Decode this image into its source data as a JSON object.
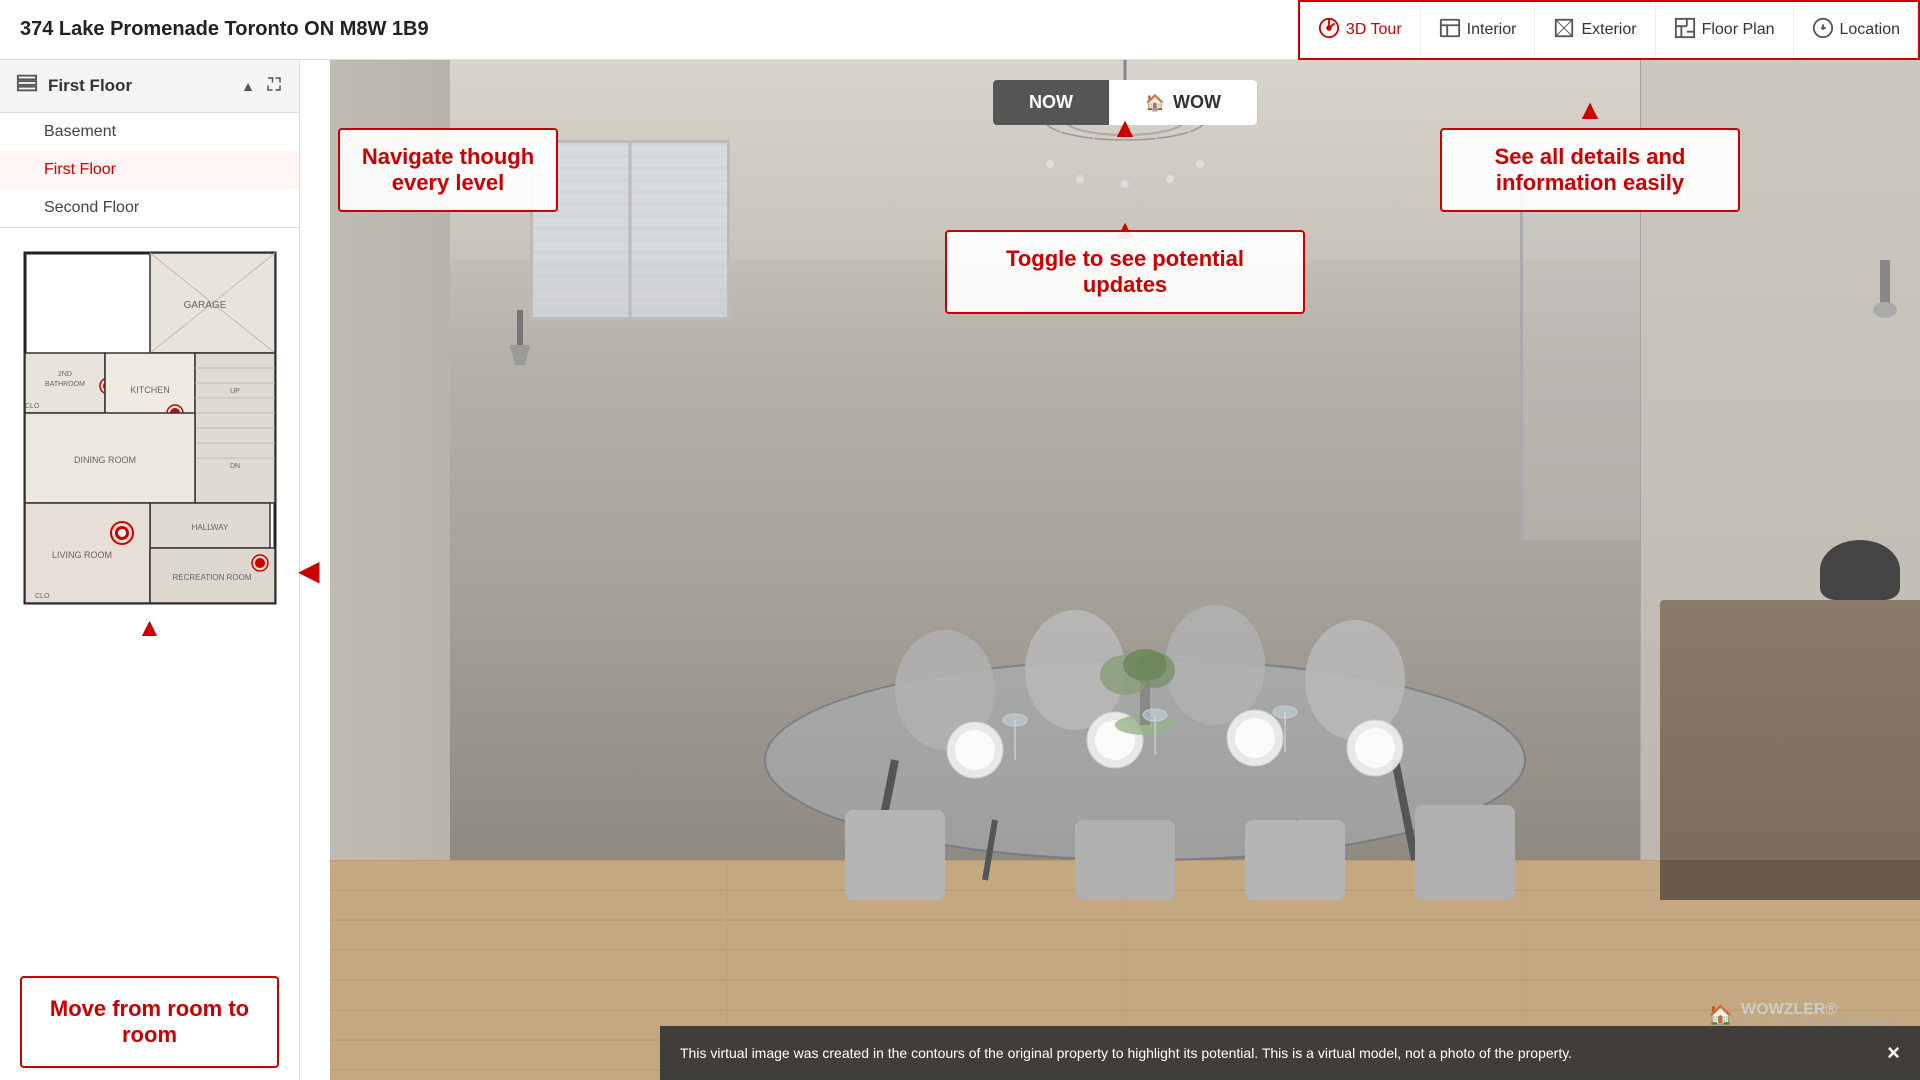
{
  "header": {
    "address": "374 Lake Promenade Toronto ON M8W 1B9"
  },
  "nav": {
    "items": [
      {
        "id": "3dtour",
        "label": "3D Tour",
        "icon": "⟳",
        "active": true
      },
      {
        "id": "interior",
        "label": "Interior",
        "icon": "🏠",
        "active": false
      },
      {
        "id": "exterior",
        "label": "Exterior",
        "icon": "🖼",
        "active": false
      },
      {
        "id": "floorplan",
        "label": "Floor Plan",
        "icon": "📋",
        "active": false
      },
      {
        "id": "location",
        "label": "Location",
        "icon": "ℹ",
        "active": false
      }
    ]
  },
  "sidebar": {
    "floor_selector_label": "First Floor",
    "floors": [
      {
        "id": "basement",
        "label": "Basement",
        "active": false
      },
      {
        "id": "first",
        "label": "First Floor",
        "active": true
      },
      {
        "id": "second",
        "label": "Second Floor",
        "active": false
      }
    ]
  },
  "toggle": {
    "now_label": "NOW",
    "wow_label": "WOW",
    "active": "wow"
  },
  "callouts": {
    "navigate": "Navigate though every level",
    "toggle": "Toggle to see potential updates",
    "details": "See all details and information easily",
    "move": "Move from room to room"
  },
  "notification": {
    "text": "This virtual image was created in the contours of the original property to highlight its potential. This is a virtual model, not a photo of the property.",
    "close_label": "×"
  },
  "branding": {
    "logo": "WOWZLER®",
    "tagline": "FULL VIRTUAL RENOVATION"
  }
}
